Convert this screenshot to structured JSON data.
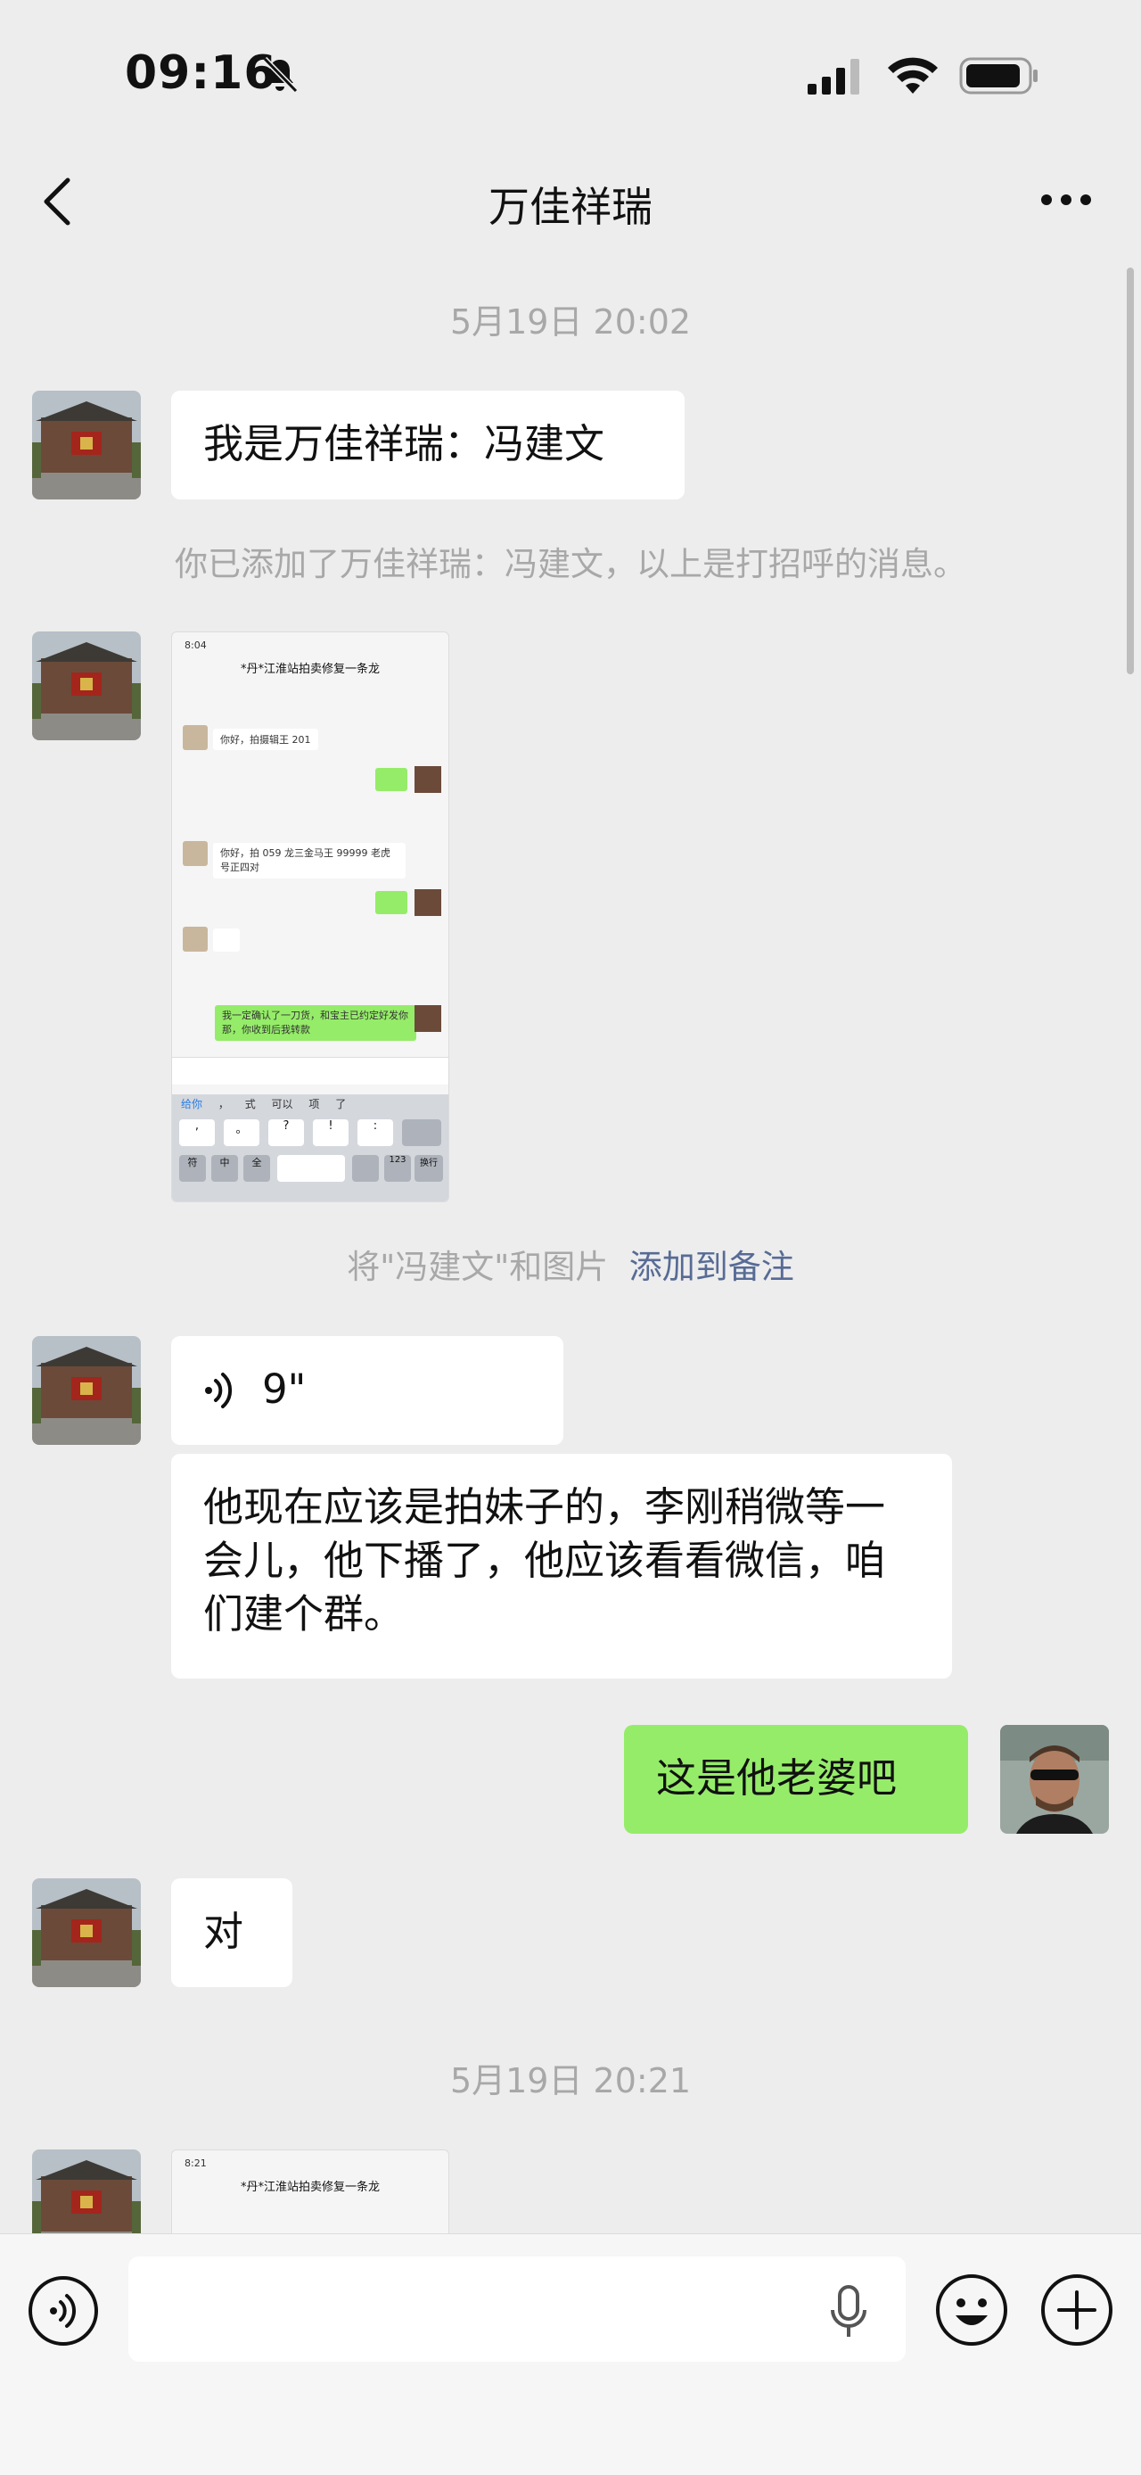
{
  "status_bar": {
    "time": "09:16"
  },
  "header": {
    "title": "万佳祥瑞"
  },
  "messages": {
    "timestamp1": "5月19日 20:02",
    "intro_text": "我是万佳祥瑞：冯建文",
    "added_notice": "你已添加了万佳祥瑞：冯建文，以上是打招呼的消息。",
    "remark_hint": "将\"冯建文\"和图片",
    "remark_link": "添加到备注",
    "voice_duration": "9\"",
    "long_text": "他现在应该是拍妹子的，李刚稍微等一会儿，他下播了，他应该看看微信，咱们建个群。",
    "my_text": "这是他老婆吧",
    "reply_text": "对",
    "timestamp2": "5月19日 20:21"
  },
  "screenshot1": {
    "time": "8:04",
    "title": "*丹*江淮站拍卖修复一条龙",
    "msg1": "你好，拍摄辑王 201",
    "msg2": "你好，拍 059 龙三金马王 99999 老虎号正四对",
    "msg3": "我一定确认了一刀货，和宝主已约定好发你那，你收到后我转款",
    "kb_row1": [
      "给你",
      "，",
      "式",
      "可以",
      "项",
      "了"
    ],
    "kb_keys": [
      ",",
      "。",
      "?",
      "!",
      ":"
    ],
    "kb_bottom": [
      "符",
      "中",
      "全",
      "123",
      "换行"
    ]
  },
  "screenshot2": {
    "time": "8:21",
    "title": "*丹*江淮站拍卖修复一条龙"
  },
  "colors": {
    "background": "#ededed",
    "bubble_mine": "#95ec69",
    "bubble_other": "#ffffff",
    "link": "#576b95",
    "muted_text": "#a8a8a8"
  },
  "icons": [
    "back-icon",
    "more-icon",
    "voice-wave-icon",
    "microphone-icon",
    "emoji-icon",
    "plus-icon",
    "voice-input-icon",
    "bell-muted-icon",
    "signal-icon",
    "wifi-icon",
    "battery-icon"
  ]
}
